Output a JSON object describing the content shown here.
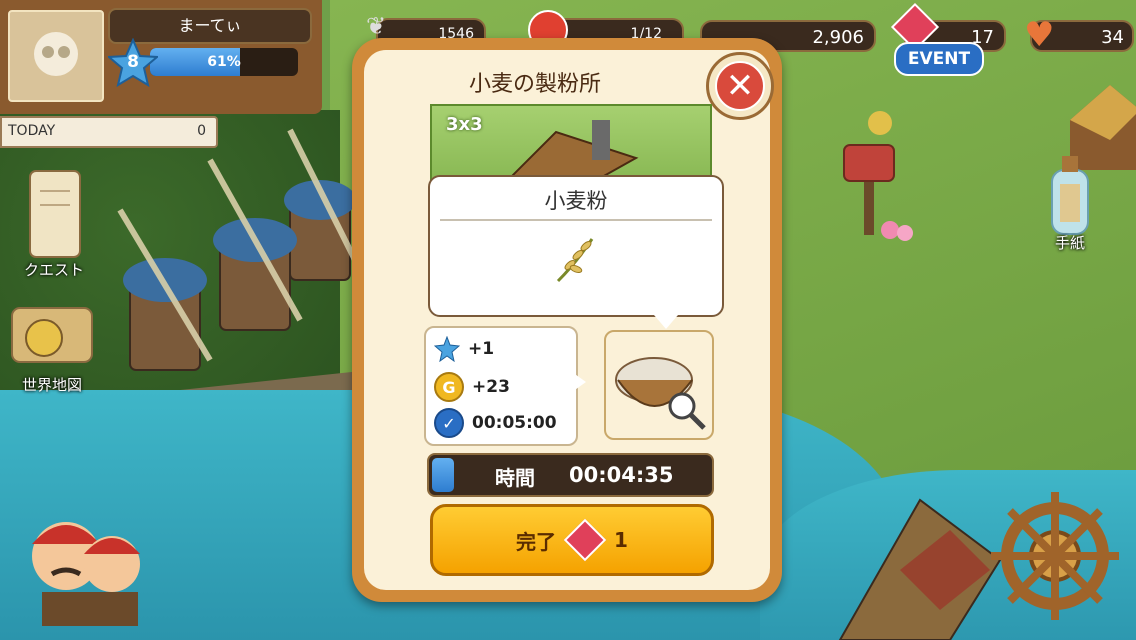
{
  "player": {
    "name": "まーてぃ",
    "level": "8",
    "exp_percent": "61%",
    "exp_fraction": 0.61
  },
  "today": {
    "label": "TODAY",
    "value": "0"
  },
  "resources": {
    "wings": "1546",
    "mushrooms": "1/12",
    "coins": "2,906",
    "gems": "17",
    "hearts": "34",
    "event_label": "EVENT"
  },
  "side_menu": {
    "quest": "クエスト",
    "world_map": "世界地図",
    "letters": "手紙"
  },
  "building_modal": {
    "title": "小麦の製粉所",
    "size": "3x3",
    "product_name": "小麦粉",
    "rewards": {
      "exp": "+1",
      "coins": "+23",
      "time": "00:05:00"
    },
    "timer_label": "時間",
    "timer_value": "00:04:35",
    "timer_progress": 0.08,
    "complete_label": "完了",
    "complete_cost": "1"
  },
  "colors": {
    "accent_orange": "#f5a200",
    "close_red": "#d94a3c",
    "exp_blue": "#3a8fe0",
    "gem_red": "#e0405a"
  }
}
